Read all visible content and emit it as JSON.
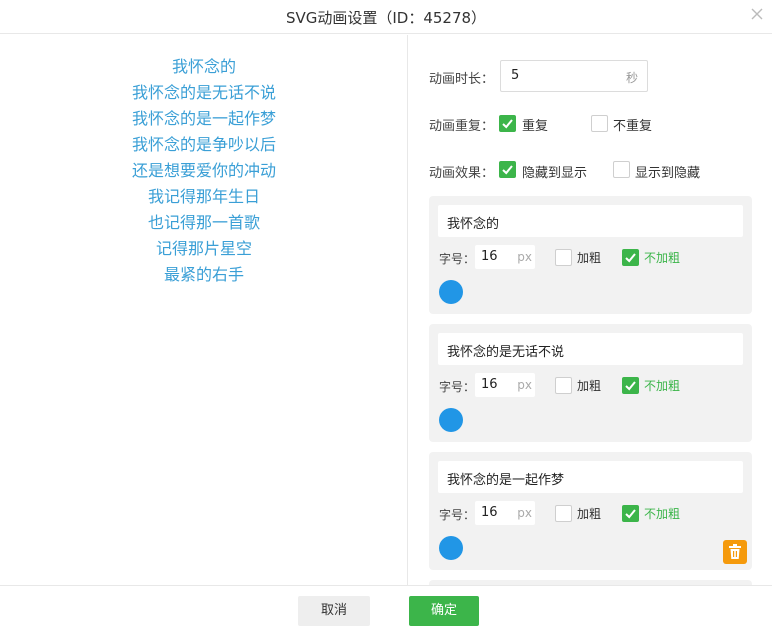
{
  "dialog": {
    "title": "SVG动画设置（ID：45278）",
    "close_icon": "close-icon"
  },
  "preview": {
    "color": "#3a9fd6",
    "lines": [
      "我怀念的",
      "我怀念的是无话不说",
      "我怀念的是一起作梦",
      "我怀念的是争吵以后",
      "还是想要爱你的冲动",
      "我记得那年生日",
      "也记得那一首歌",
      "记得那片星空",
      "最紧的右手"
    ]
  },
  "settings": {
    "duration": {
      "label": "动画时长：",
      "value": "5",
      "unit": "秒"
    },
    "repeat": {
      "label": "动画重复：",
      "options": [
        {
          "label": "重复",
          "checked": true
        },
        {
          "label": "不重复",
          "checked": false
        }
      ]
    },
    "effect": {
      "label": "动画效果：",
      "options": [
        {
          "label": "隐藏到显示",
          "checked": true
        },
        {
          "label": "显示到隐藏",
          "checked": false
        }
      ]
    },
    "cards": [
      {
        "text": "我怀念的",
        "size_label": "字号：",
        "size": "16",
        "unit": "px",
        "bold_label": "加粗",
        "bold": false,
        "nobold_label": "不加粗",
        "nobold": true,
        "color": "#2196e6"
      },
      {
        "text": "我怀念的是无话不说",
        "size_label": "字号：",
        "size": "16",
        "unit": "px",
        "bold_label": "加粗",
        "bold": false,
        "nobold_label": "不加粗",
        "nobold": true,
        "color": "#2196e6"
      },
      {
        "text": "我怀念的是一起作梦",
        "size_label": "字号：",
        "size": "16",
        "unit": "px",
        "bold_label": "加粗",
        "bold": false,
        "nobold_label": "不加粗",
        "nobold": true,
        "color": "#2196e6",
        "delete_icon": "trash-icon"
      }
    ]
  },
  "footer": {
    "cancel": "取消",
    "ok": "确定"
  },
  "colors": {
    "accent": "#3cb54a",
    "delete": "#f59a0c"
  }
}
